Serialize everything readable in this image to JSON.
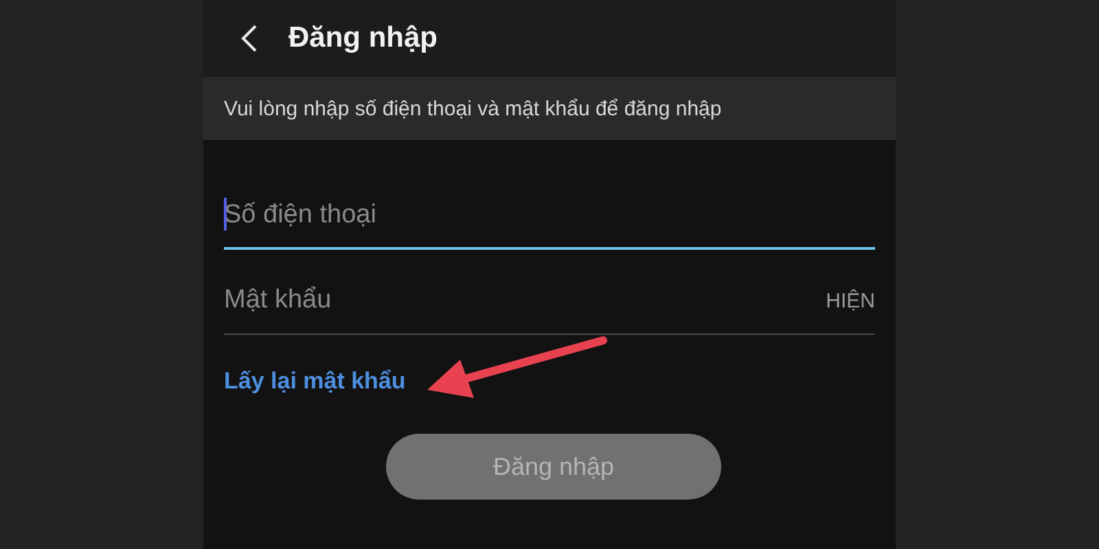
{
  "header": {
    "title": "Đăng nhập"
  },
  "instruction": "Vui lòng nhập số điện thoại và mật khẩu để đăng nhập",
  "fields": [
    {
      "placeholder": "Số điện thoại",
      "focused": true
    },
    {
      "placeholder": "Mật khẩu",
      "focused": false,
      "toggle": "HIỆN"
    }
  ],
  "forgot_link": "Lấy lại mật khẩu",
  "login_button": {
    "label": "Đăng nhập",
    "disabled": true
  },
  "annotations": [
    {
      "kind": "arrow"
    }
  ]
}
